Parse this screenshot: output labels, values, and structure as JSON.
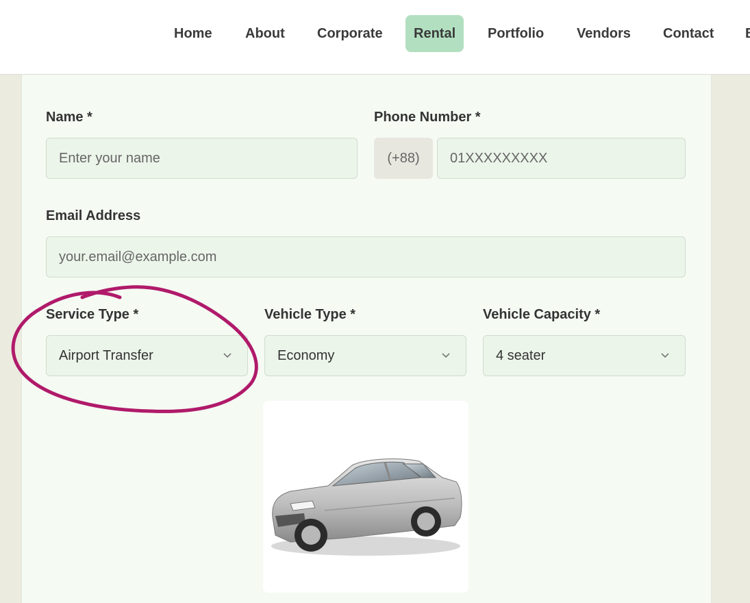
{
  "nav": {
    "items": [
      {
        "label": "Home"
      },
      {
        "label": "About"
      },
      {
        "label": "Corporate"
      },
      {
        "label": "Rental"
      },
      {
        "label": "Portfolio"
      },
      {
        "label": "Vendors"
      },
      {
        "label": "Contact"
      },
      {
        "label": "B"
      }
    ],
    "active": "Rental",
    "active_color": "#b2dfc0"
  },
  "form": {
    "name": {
      "label": "Name *",
      "placeholder": "Enter your name"
    },
    "phone": {
      "label": "Phone Number *",
      "prefix": "(+88)",
      "placeholder": "01XXXXXXXXX"
    },
    "email": {
      "label": "Email Address",
      "placeholder": "your.email@example.com"
    },
    "service_type": {
      "label": "Service Type *",
      "value": "Airport Transfer"
    },
    "vehicle_type": {
      "label": "Vehicle Type *",
      "value": "Economy"
    },
    "vehicle_capacity": {
      "label": "Vehicle Capacity *",
      "value": "4 seater"
    }
  },
  "annotation": {
    "color": "#b01a6a"
  }
}
